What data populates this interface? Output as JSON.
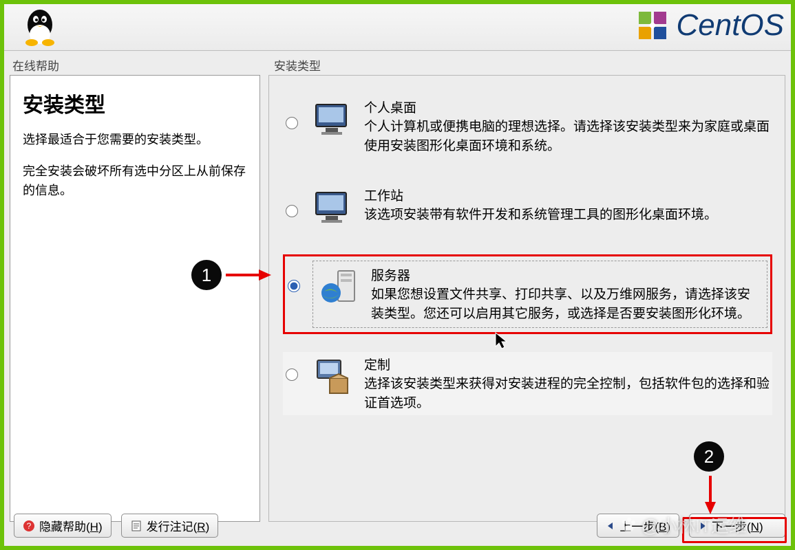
{
  "brand": "CentOS",
  "help": {
    "panel_label": "在线帮助",
    "title": "安装类型",
    "para1": "选择最适合于您需要的安装类型。",
    "para2": "完全安装会破坏所有选中分区上从前保存的信息。"
  },
  "group": {
    "label": "安装类型",
    "options": [
      {
        "key": "desktop",
        "title": "个人桌面",
        "desc": "个人计算机或便携电脑的理想选择。请选择该安装类型来为家庭或桌面使用安装图形化桌面环境和系统。",
        "selected": false
      },
      {
        "key": "workstation",
        "title": "工作站",
        "desc": "该选项安装带有软件开发和系统管理工具的图形化桌面环境。",
        "selected": false
      },
      {
        "key": "server",
        "title": "服务器",
        "desc": "如果您想设置文件共享、打印共享、以及万维网服务，请选择该安装类型。您还可以启用其它服务，或选择是否要安装图形化环境。",
        "selected": true
      },
      {
        "key": "custom",
        "title": "定制",
        "desc": "选择该安装类型来获得对安装进程的完全控制，包括软件包的选择和验证首选项。",
        "selected": false
      }
    ]
  },
  "buttons": {
    "hide_help": "隐藏帮助",
    "hide_help_key": "H",
    "release_notes": "发行注记",
    "release_notes_key": "R",
    "back": "上一步",
    "back_key": "B",
    "next": "下一步",
    "next_key": "N"
  },
  "annotations": {
    "badge1": "1",
    "badge2": "2"
  },
  "watermark": "@小林IT运维"
}
